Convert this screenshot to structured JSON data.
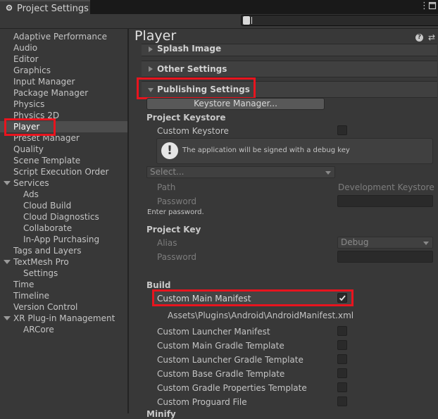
{
  "window": {
    "title": "Project Settings"
  },
  "search": {
    "value": ""
  },
  "sidebar": {
    "items": [
      {
        "label": "Adaptive Performance"
      },
      {
        "label": "Audio"
      },
      {
        "label": "Editor"
      },
      {
        "label": "Graphics"
      },
      {
        "label": "Input Manager"
      },
      {
        "label": "Package Manager"
      },
      {
        "label": "Physics"
      },
      {
        "label": "Physics 2D"
      },
      {
        "label": "Player"
      },
      {
        "label": "Preset Manager"
      },
      {
        "label": "Quality"
      },
      {
        "label": "Scene Template"
      },
      {
        "label": "Script Execution Order"
      },
      {
        "label": "Services"
      },
      {
        "label": "Ads"
      },
      {
        "label": "Cloud Build"
      },
      {
        "label": "Cloud Diagnostics"
      },
      {
        "label": "Collaborate"
      },
      {
        "label": "In-App Purchasing"
      },
      {
        "label": "Tags and Layers"
      },
      {
        "label": "TextMesh Pro"
      },
      {
        "label": "Settings"
      },
      {
        "label": "Time"
      },
      {
        "label": "Timeline"
      },
      {
        "label": "Version Control"
      },
      {
        "label": "XR Plug-in Management"
      },
      {
        "label": "ARCore"
      }
    ]
  },
  "main": {
    "title": "Player",
    "foldouts": {
      "splash": "Splash Image",
      "other": "Other Settings",
      "publishing": "Publishing Settings"
    },
    "keystore_manager_button": "Keystore Manager...",
    "project_keystore": {
      "header": "Project Keystore",
      "custom_keystore": "Custom Keystore",
      "info_message": "The application will be signed with a debug key",
      "select_placeholder": "Select...",
      "path_label": "Path",
      "path_value": "Development Keystore",
      "password_label": "Password",
      "enter_password": "Enter password."
    },
    "project_key": {
      "header": "Project Key",
      "alias_label": "Alias",
      "alias_value": "Debug",
      "password_label": "Password"
    },
    "build": {
      "header": "Build",
      "custom_main_manifest": "Custom Main Manifest",
      "custom_main_manifest_checked": true,
      "manifest_path": "Assets\\Plugins\\Android\\AndroidManifest.xml",
      "options": [
        {
          "label": "Custom Launcher Manifest",
          "checked": false
        },
        {
          "label": "Custom Main Gradle Template",
          "checked": false
        },
        {
          "label": "Custom Launcher Gradle Template",
          "checked": false
        },
        {
          "label": "Custom Base Gradle Template",
          "checked": false
        },
        {
          "label": "Custom Gradle Properties Template",
          "checked": false
        },
        {
          "label": "Custom Proguard File",
          "checked": false
        }
      ],
      "next_section_partial": "Minify"
    }
  },
  "colors": {
    "highlight_box": "#e8141e",
    "selected_row": "#4d4d4d"
  }
}
